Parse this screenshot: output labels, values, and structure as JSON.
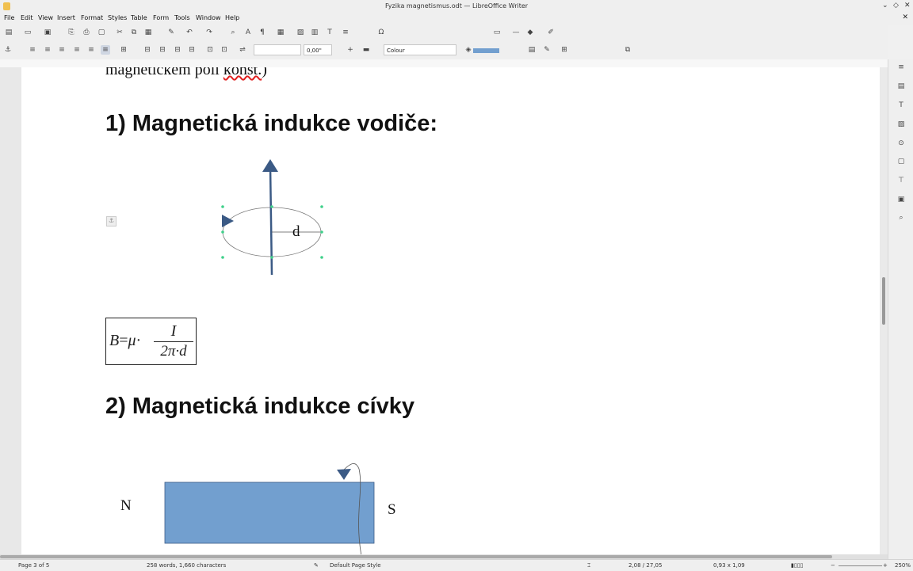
{
  "window": {
    "title": "Fyzika magnetismus.odt — LibreOffice Writer"
  },
  "menu": [
    "File",
    "Edit",
    "View",
    "Insert",
    "Format",
    "Styles",
    "Table",
    "Form",
    "Tools",
    "Window",
    "Help"
  ],
  "toolbar2": {
    "line_width": "0,00\"",
    "area_style": "Colour"
  },
  "document": {
    "partial_text": "magnetickém poli ",
    "partial_text_misspelled": "konst.",
    "partial_text_end": ")",
    "heading1": "1) Magnetická indukce vodiče:",
    "distance_label": "d",
    "formula": {
      "lhs": "B",
      "mu": "μ",
      "numerator": "I",
      "denominator": "2π·d"
    },
    "heading2": "2) Magnetická indukce cívky",
    "magnet_north": "N",
    "magnet_south": "S"
  },
  "status": {
    "page": "Page 3 of 5",
    "words": "258 words, 1,660 characters",
    "page_style": "Default Page Style",
    "position": "2,08 / 27,05",
    "size": "0,93 x 1,09",
    "zoom": "250%"
  },
  "colors": {
    "arrow": "#3b5a85",
    "magnet": "#729fcf",
    "handle": "#3fd08a"
  }
}
